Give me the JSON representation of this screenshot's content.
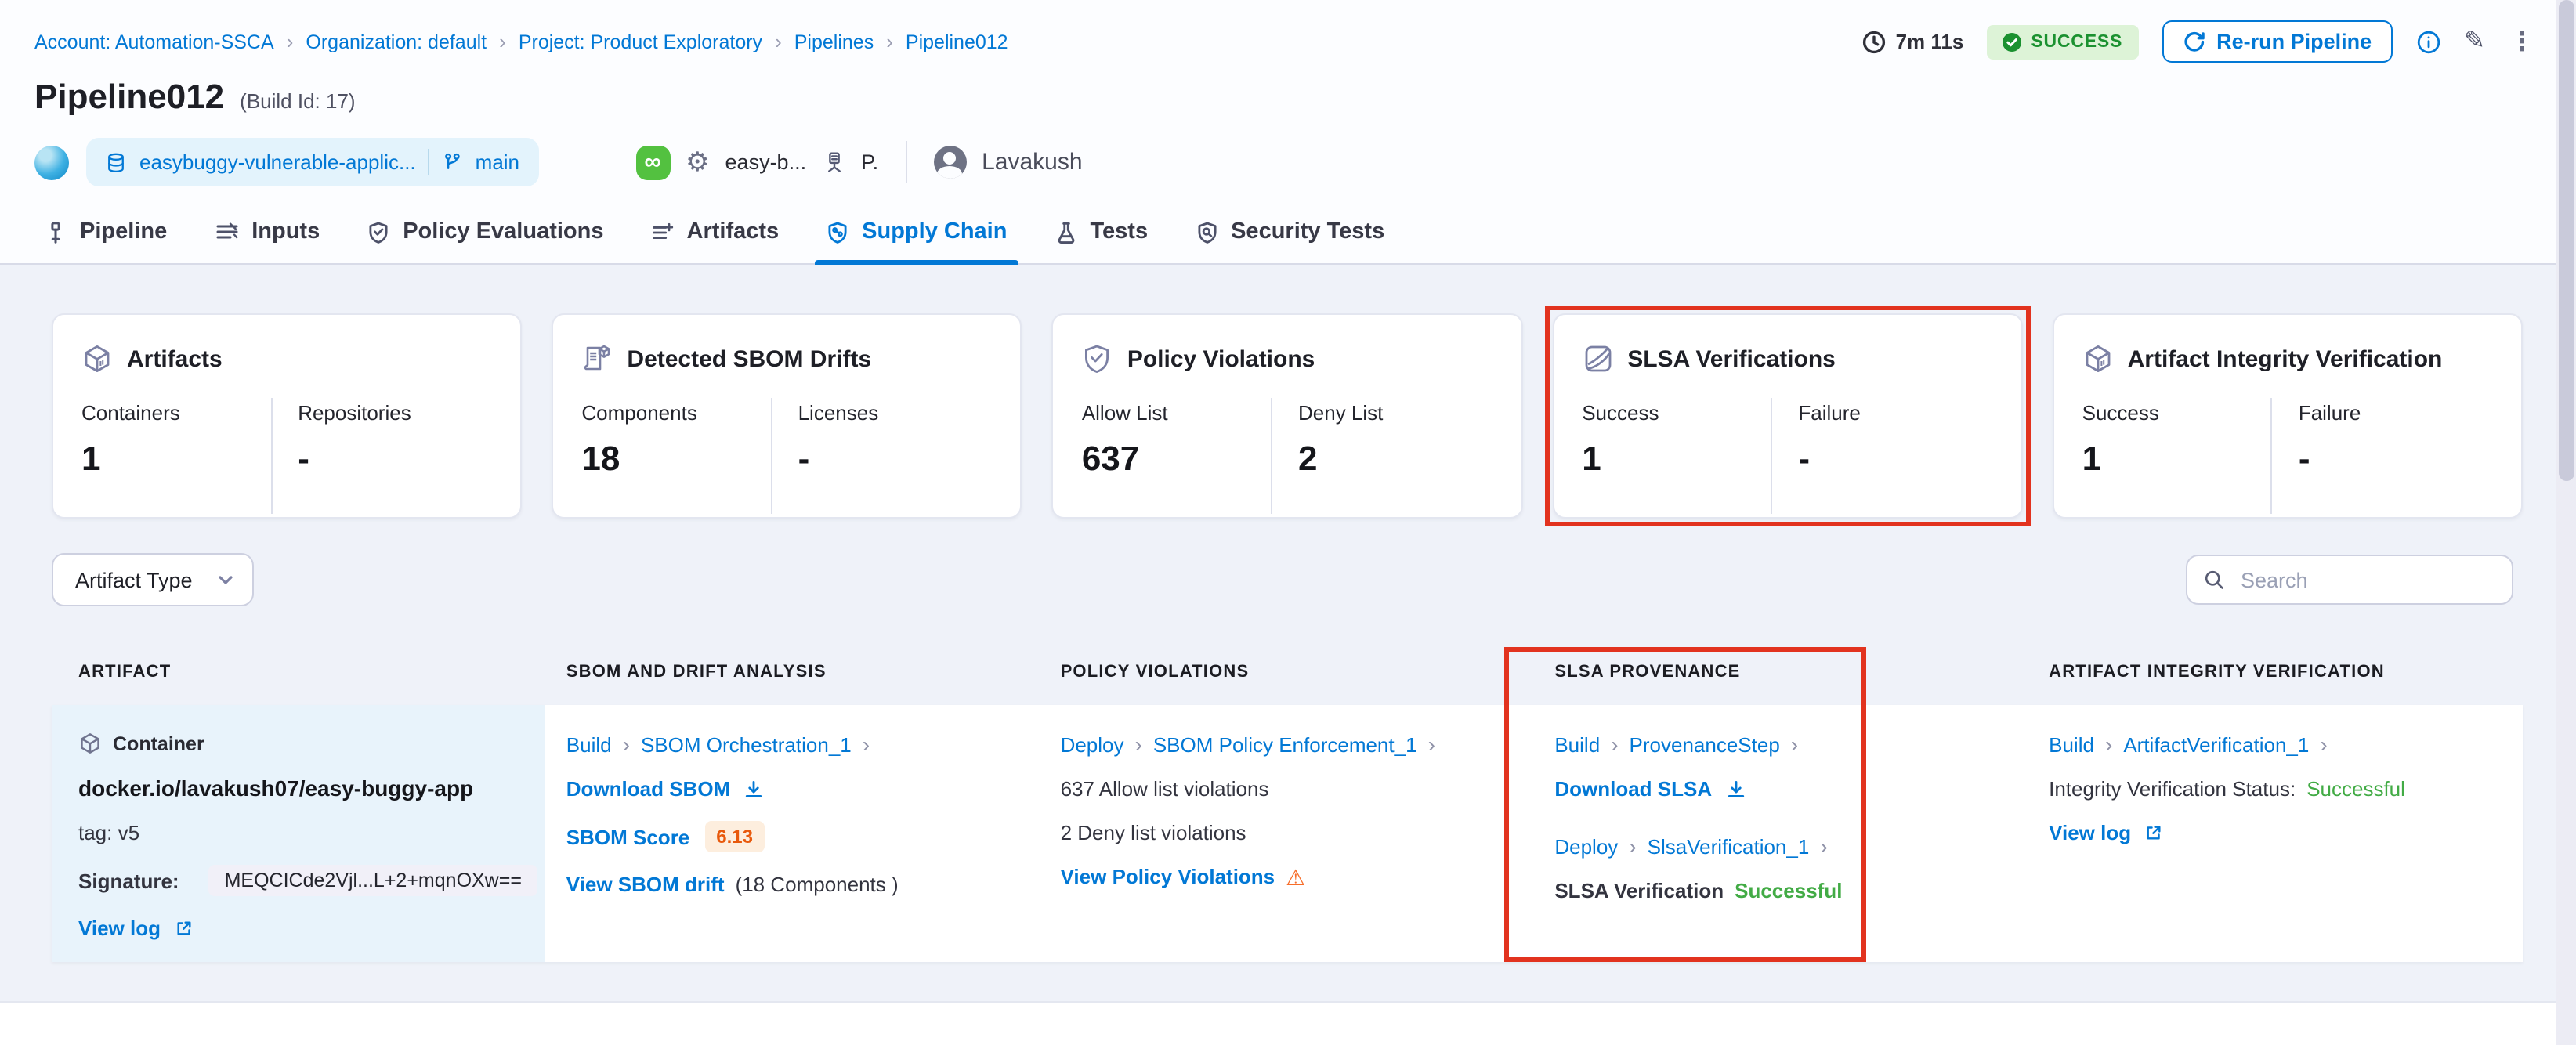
{
  "icons": {
    "breadcrumb_chevron": "›",
    "link_chevron": "›",
    "warning": "⚠",
    "gear": "⚙",
    "infinity": "∞",
    "pencil": "✎",
    "kebab": "⋮"
  },
  "breadcrumb": {
    "items": [
      "Account: Automation-SSCA",
      "Organization: default",
      "Project: Product Exploratory",
      "Pipelines",
      "Pipeline012"
    ]
  },
  "topbar": {
    "duration": "7m 11s",
    "status": "SUCCESS",
    "rerun_label": "Re-run Pipeline"
  },
  "header": {
    "title": "Pipeline012",
    "build_id": "(Build Id: 17)",
    "repo": "easybuggy-vulnerable-applic...",
    "branch": "main",
    "connector": "easy-b...",
    "trigger_initial": "P.",
    "user": "Lavakush"
  },
  "tabs": [
    {
      "label": "Pipeline"
    },
    {
      "label": "Inputs"
    },
    {
      "label": "Policy Evaluations"
    },
    {
      "label": "Artifacts"
    },
    {
      "label": "Supply Chain"
    },
    {
      "label": "Tests"
    },
    {
      "label": "Security Tests"
    }
  ],
  "summary_cards": [
    {
      "title": "Artifacts",
      "stats": [
        {
          "label": "Containers",
          "value": "1"
        },
        {
          "label": "Repositories",
          "value": "-"
        }
      ]
    },
    {
      "title": "Detected SBOM Drifts",
      "stats": [
        {
          "label": "Components",
          "value": "18"
        },
        {
          "label": "Licenses",
          "value": "-"
        }
      ]
    },
    {
      "title": "Policy Violations",
      "stats": [
        {
          "label": "Allow List",
          "value": "637"
        },
        {
          "label": "Deny List",
          "value": "2"
        }
      ]
    },
    {
      "title": "SLSA Verifications",
      "stats": [
        {
          "label": "Success",
          "value": "1"
        },
        {
          "label": "Failure",
          "value": "-"
        }
      ]
    },
    {
      "title": "Artifact Integrity Verification",
      "stats": [
        {
          "label": "Success",
          "value": "1"
        },
        {
          "label": "Failure",
          "value": "-"
        }
      ]
    }
  ],
  "filters": {
    "artifact_type": "Artifact Type",
    "search_placeholder": "Search"
  },
  "table": {
    "columns": [
      "ARTIFACT",
      "SBOM AND DRIFT ANALYSIS",
      "POLICY VIOLATIONS",
      "SLSA PROVENANCE",
      "ARTIFACT INTEGRITY VERIFICATION"
    ],
    "row": {
      "artifact": {
        "type_label": "Container",
        "image": "docker.io/lavakush07/easy-buggy-app",
        "tag": "tag: v5",
        "signature_label": "Signature:",
        "signature_value": "MEQCICde2Vjl...L+2+mqnOXw==",
        "view_log": "View log"
      },
      "sbom": {
        "stage": "Build",
        "step": "SBOM Orchestration_1",
        "download": "Download SBOM",
        "score_label": "SBOM Score",
        "score": "6.13",
        "drift_link": "View SBOM drift",
        "drift_suffix": "(18 Components )"
      },
      "policy": {
        "stage": "Deploy",
        "step": "SBOM Policy Enforcement_1",
        "allow": "637 Allow list violations",
        "deny": "2 Deny list violations",
        "view": "View Policy Violations"
      },
      "slsa": {
        "build_stage": "Build",
        "build_step": "ProvenanceStep",
        "download": "Download SLSA",
        "deploy_stage": "Deploy",
        "deploy_step": "SlsaVerification_1",
        "status_label": "SLSA Verification",
        "status_value": "Successful"
      },
      "integrity": {
        "stage": "Build",
        "step": "ArtifactVerification_1",
        "status_label": "Integrity Verification Status:",
        "status_value": "Successful",
        "view_log": "View log"
      }
    }
  },
  "colors": {
    "accent": "#0278d5",
    "success_text": "#42ab45",
    "success_badge_bg": "#ddf3d7",
    "highlight_red": "#e2331f",
    "warning_orange": "#f76e2a",
    "score_orange": "#e8590c",
    "artifact_cell_bg": "#e8f3fb"
  }
}
